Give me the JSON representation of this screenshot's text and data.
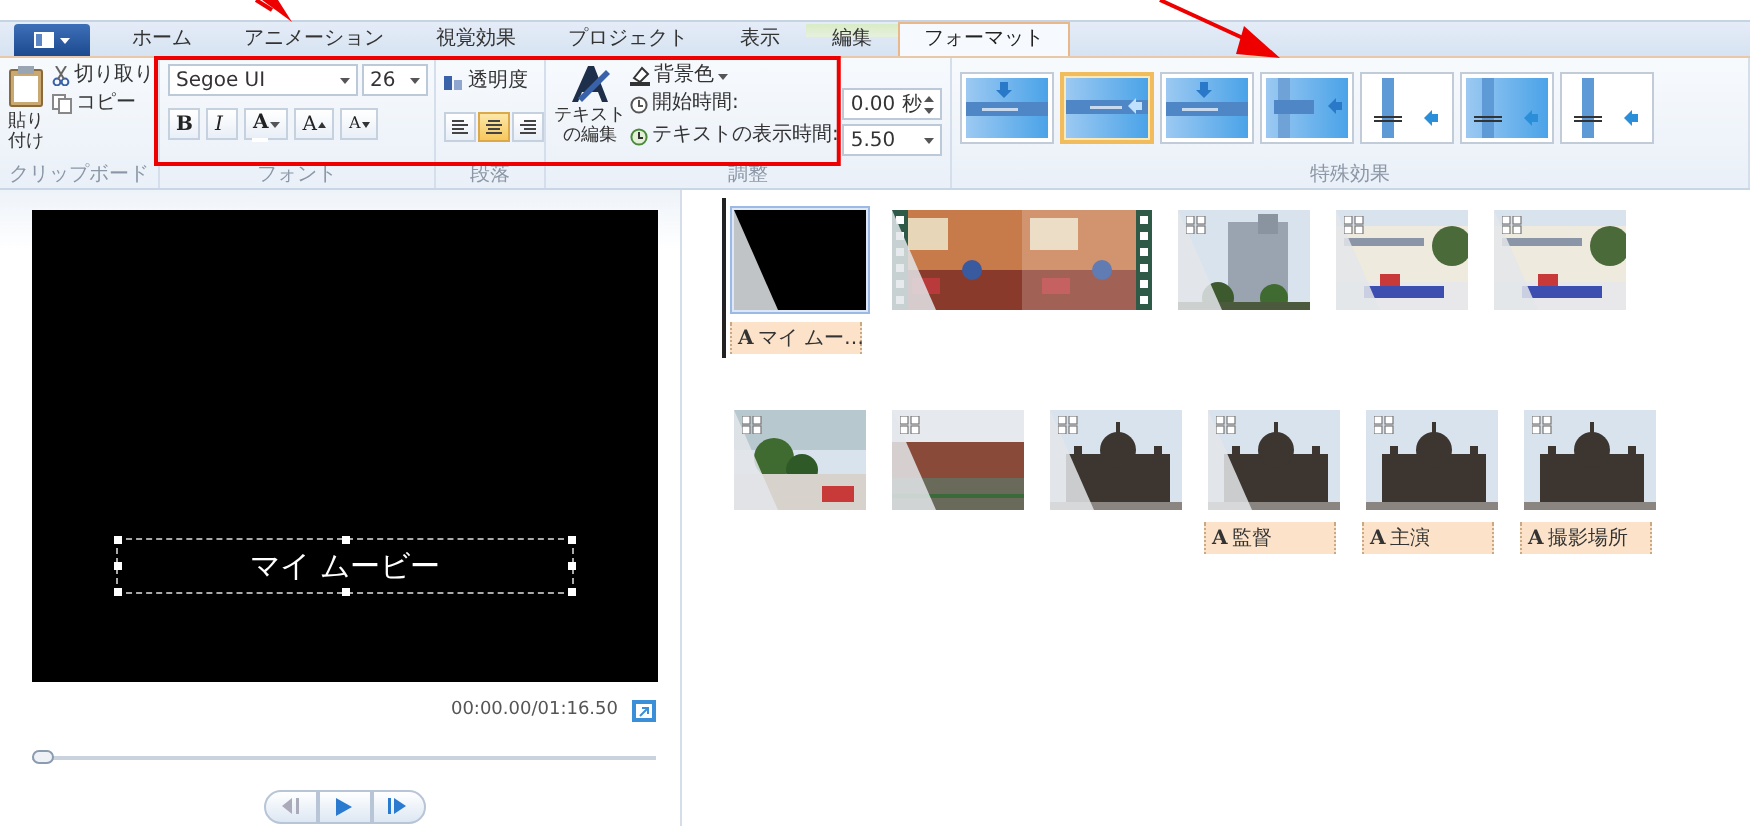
{
  "tabs": [
    {
      "label": "ホーム",
      "selected": false,
      "contextual": false
    },
    {
      "label": "アニメーション",
      "selected": false,
      "contextual": false
    },
    {
      "label": "視覚効果",
      "selected": false,
      "contextual": false
    },
    {
      "label": "プロジェクト",
      "selected": false,
      "contextual": false
    },
    {
      "label": "表示",
      "selected": false,
      "contextual": false
    },
    {
      "label": "編集",
      "selected": false,
      "contextual": true
    },
    {
      "label": "フォーマット",
      "selected": true,
      "contextual": false
    }
  ],
  "clipboard": {
    "label": "クリップボード",
    "paste": [
      "貼り",
      "付け"
    ],
    "cut": "切り取り",
    "copy": "コピー"
  },
  "font": {
    "label": "フォント",
    "family": "Segoe UI",
    "size": "26",
    "buttons": [
      {
        "kind": "bold",
        "text": "B"
      },
      {
        "kind": "italic",
        "text": "I"
      },
      {
        "kind": "color",
        "text": "A"
      },
      {
        "kind": "grow",
        "text": "A"
      },
      {
        "kind": "shrink",
        "text": "A"
      }
    ]
  },
  "paragraph": {
    "label": "段落",
    "transparency": "透明度",
    "align": [
      {
        "kind": "left",
        "selected": false
      },
      {
        "kind": "center",
        "selected": true
      },
      {
        "kind": "right",
        "selected": false
      }
    ]
  },
  "adjust": {
    "label": "調整",
    "edit_text": [
      "テキスト",
      "の編集"
    ],
    "background": "背景色",
    "start_label": "開始時間:",
    "start_value": "0.00 秒",
    "duration_label": "テキストの表示時間:",
    "duration_value": "5.50"
  },
  "effects": {
    "label": "特殊効果",
    "items": [
      {
        "kind": "drop",
        "selected": false
      },
      {
        "kind": "slide",
        "selected": true
      },
      {
        "kind": "drop",
        "selected": false
      },
      {
        "kind": "stripe",
        "selected": false
      },
      {
        "kind": "line",
        "selected": false
      },
      {
        "kind": "line-fill",
        "selected": false
      },
      {
        "kind": "line",
        "selected": false
      }
    ]
  },
  "preview": {
    "caption": "マイ ムービー",
    "time": "00:00.00/01:16.50",
    "seek": {
      "level": 0
    }
  },
  "storyboard": {
    "rows": [
      [
        {
          "kind": "title",
          "selected": true,
          "transition": true,
          "pan_zoom": false,
          "caption": {
            "mark": "A",
            "text": "マイ ムー…"
          }
        },
        {
          "kind": "video",
          "selected": false,
          "transition": true,
          "pan_zoom": false
        },
        {
          "kind": "picture",
          "selected": false,
          "transition": true,
          "pan_zoom": true
        },
        {
          "kind": "picture",
          "selected": false,
          "transition": true,
          "pan_zoom": true
        },
        {
          "kind": "picture",
          "selected": false,
          "transition": true,
          "pan_zoom": true
        }
      ],
      [
        {
          "kind": "picture",
          "selected": false,
          "transition": true,
          "pan_zoom": true
        },
        {
          "kind": "picture",
          "selected": false,
          "transition": true,
          "pan_zoom": true
        },
        {
          "kind": "picture",
          "selected": false,
          "transition": true,
          "pan_zoom": true
        },
        {
          "kind": "picture",
          "selected": false,
          "transition": true,
          "pan_zoom": true,
          "caption": {
            "mark": "A",
            "text": "監督"
          }
        },
        {
          "kind": "picture",
          "selected": false,
          "transition": false,
          "pan_zoom": true,
          "caption": {
            "mark": "A",
            "text": "主演"
          }
        },
        {
          "kind": "picture",
          "selected": false,
          "transition": false,
          "pan_zoom": true,
          "caption": {
            "mark": "A",
            "text": "撮影場所"
          }
        }
      ]
    ]
  }
}
